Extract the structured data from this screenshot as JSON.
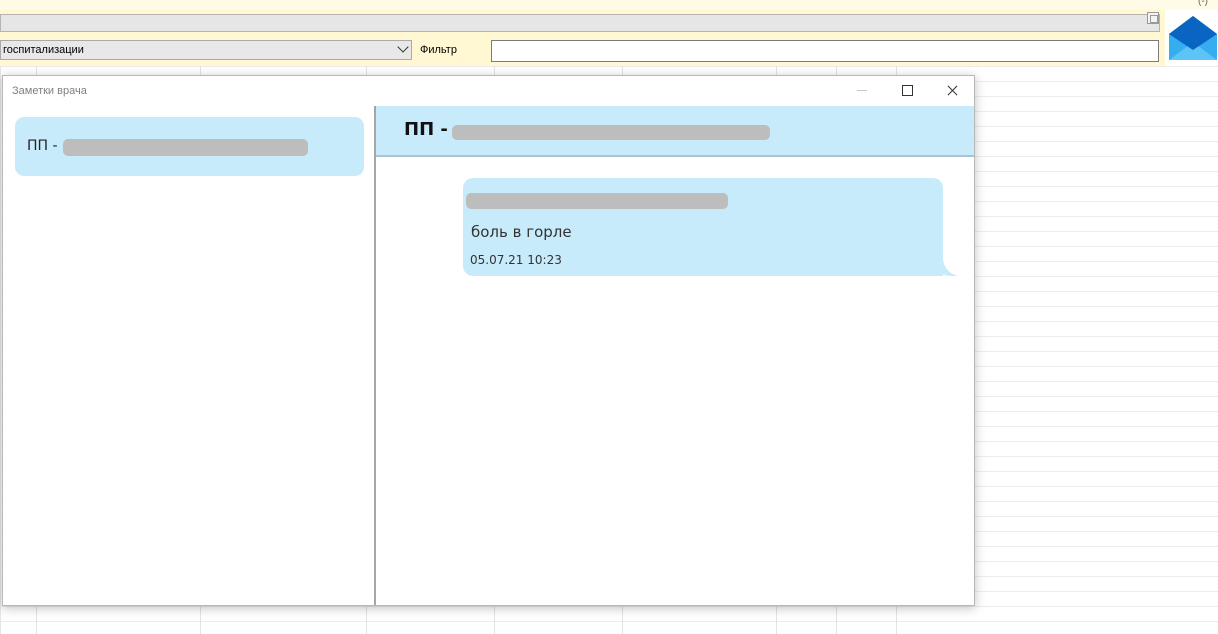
{
  "app": {
    "corner_glyph": "(-)",
    "hospitalization_select": {
      "value": "госпитализации"
    },
    "filter": {
      "label": "Фильтр",
      "value": ""
    }
  },
  "dialog": {
    "title": "Заметки врача",
    "contacts": [
      {
        "label_prefix": "ПП - "
      }
    ],
    "chat": {
      "header_prefix": "ПП - ",
      "messages": [
        {
          "text": "боль в горле",
          "time": "05.07.21 10:23"
        }
      ]
    }
  },
  "colors": {
    "bubble": "#c8ebfb",
    "toolbar_bg": "#fff8d2",
    "redaction": "#bdbdbd"
  },
  "icons": [
    "mail-envelope-icon",
    "minimize-icon",
    "maximize-icon",
    "close-icon",
    "chevron-down-icon"
  ]
}
